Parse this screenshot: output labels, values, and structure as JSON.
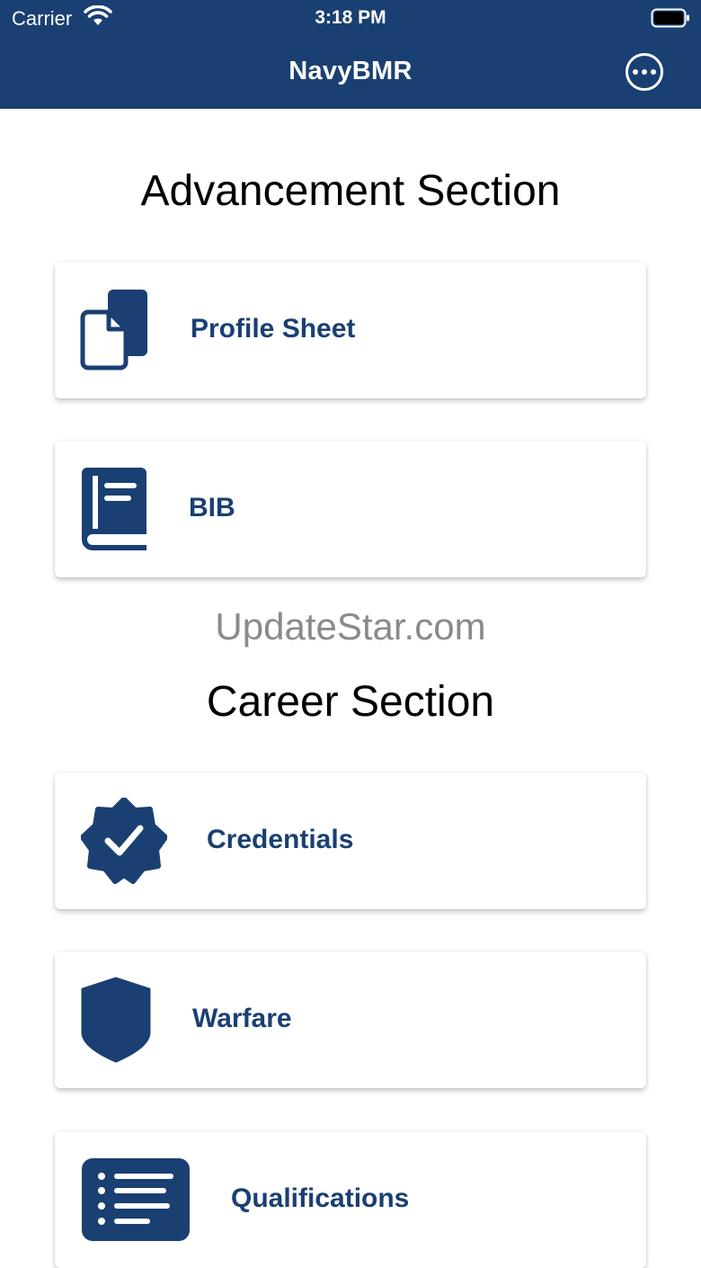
{
  "status_bar": {
    "carrier": "Carrier",
    "time": "3:18 PM"
  },
  "nav": {
    "title": "NavyBMR",
    "more_icon": "ellipsis-circle-icon"
  },
  "sections": {
    "advancement_title": "Advancement Section",
    "career_title": "Career Section"
  },
  "watermark": "UpdateStar.com",
  "cards": {
    "profile_sheet": {
      "label": "Profile Sheet",
      "icon": "documents-icon"
    },
    "bib": {
      "label": "BIB",
      "icon": "book-icon"
    },
    "credentials": {
      "label": "Credentials",
      "icon": "verified-badge-icon"
    },
    "warfare": {
      "label": "Warfare",
      "icon": "shield-icon"
    },
    "qualifications": {
      "label": "Qualifications",
      "icon": "list-icon"
    }
  },
  "colors": {
    "brand": "#1a3f72",
    "background": "#ffffff",
    "watermark": "#8a8a8a"
  }
}
